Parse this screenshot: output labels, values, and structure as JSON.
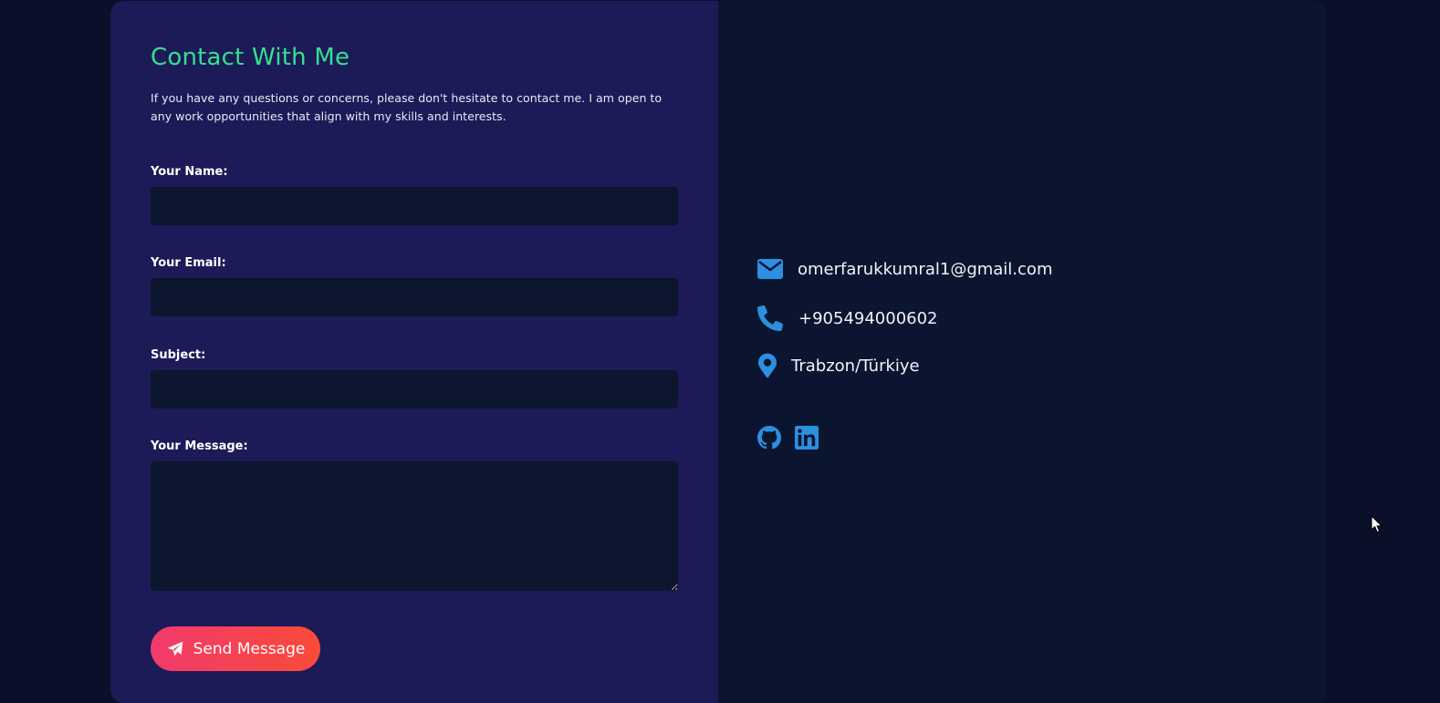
{
  "colors": {
    "page_bg": "#0a0f2a",
    "form_panel_bg": "#1c1a57",
    "info_panel_bg": "#0c1530",
    "input_bg": "#0c162e",
    "title_accent": "#34e08f",
    "icon_accent": "#2d8fe0",
    "button_gradient_start": "#f23a6d",
    "button_gradient_end": "#fa4a38"
  },
  "form": {
    "title": "Contact With Me",
    "intro": "If you have any questions or concerns, please don't hesitate to contact me. I am open to any work opportunities that align with my skills and interests.",
    "fields": {
      "name": {
        "label": "Your Name:",
        "value": "",
        "placeholder": ""
      },
      "email": {
        "label": "Your Email:",
        "value": "",
        "placeholder": ""
      },
      "subject": {
        "label": "Subject:",
        "value": "",
        "placeholder": ""
      },
      "message": {
        "label": "Your Message:",
        "value": "",
        "placeholder": ""
      }
    },
    "send_button": {
      "label": "Send Message",
      "icon": "paper-plane-icon"
    }
  },
  "contact_info": {
    "email": {
      "icon": "envelope-icon",
      "text": "omerfarukkumral1@gmail.com"
    },
    "phone": {
      "icon": "phone-icon",
      "text": "+905494000602"
    },
    "location": {
      "icon": "map-pin-icon",
      "text": "Trabzon/Türkiye"
    }
  },
  "socials": [
    {
      "icon": "github-icon"
    },
    {
      "icon": "linkedin-icon"
    }
  ]
}
